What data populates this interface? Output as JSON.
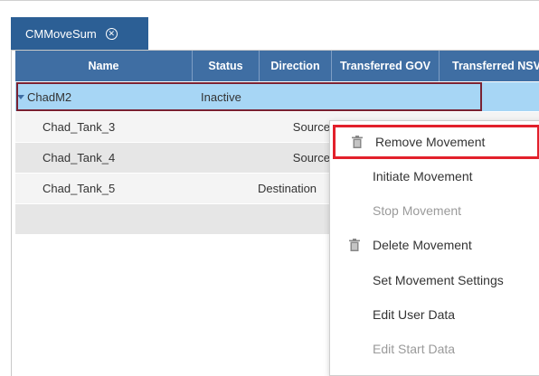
{
  "tab": {
    "label": "CMMoveSum",
    "close_icon": "close-circle-icon"
  },
  "grid": {
    "columns": [
      "Name",
      "Status",
      "Direction",
      "Transferred GOV",
      "Transferred NSV"
    ],
    "group": {
      "name": "ChadM2",
      "status": "Inactive"
    },
    "rows": [
      {
        "name": "Chad_Tank_3",
        "direction": "Source"
      },
      {
        "name": "Chad_Tank_4",
        "direction": "Source"
      },
      {
        "name": "Chad_Tank_5",
        "direction": "Destination"
      }
    ]
  },
  "context_menu": {
    "items": [
      {
        "label": "Remove Movement",
        "icon": "trash-icon",
        "enabled": true,
        "highlighted": true
      },
      {
        "label": "Initiate Movement",
        "icon": "",
        "enabled": true
      },
      {
        "label": "Stop Movement",
        "icon": "",
        "enabled": false
      },
      {
        "label": "Delete Movement",
        "icon": "trash-icon",
        "enabled": true
      },
      {
        "label": "Set Movement Settings",
        "icon": "",
        "enabled": true
      },
      {
        "label": "Edit User Data",
        "icon": "",
        "enabled": true
      },
      {
        "label": "Edit Start Data",
        "icon": "",
        "enabled": false
      }
    ]
  },
  "colors": {
    "tab_bg": "#2c5f95",
    "header_bg": "#3f6ea3",
    "selected_row": "#a7d6f5",
    "highlight_border": "#e2202b",
    "group_outline": "#7a2232"
  }
}
